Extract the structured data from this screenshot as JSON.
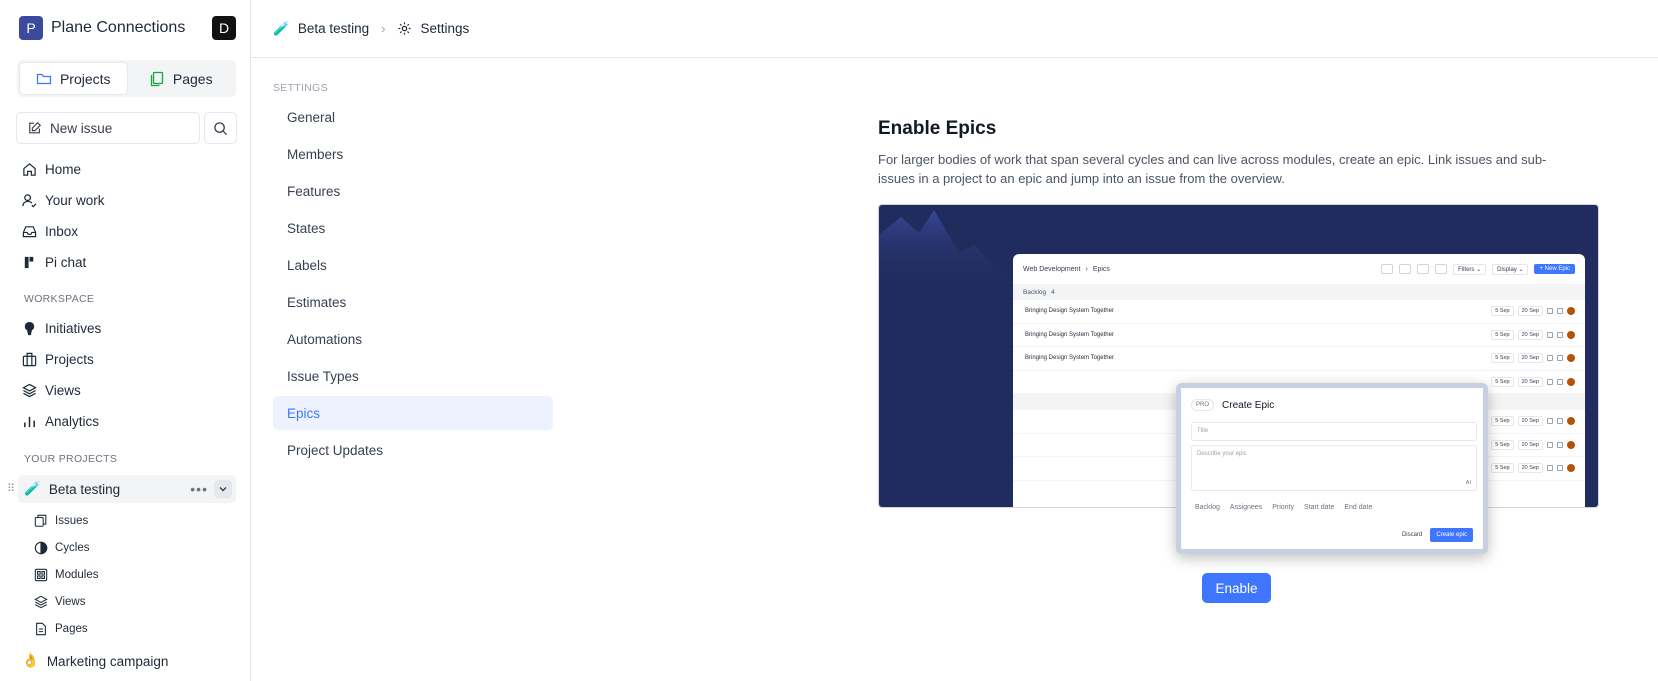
{
  "sidebar": {
    "workspace": {
      "logo_letter": "P",
      "name": "Plane Connections",
      "user_letter": "D"
    },
    "tabs": {
      "projects": "Projects",
      "pages": "Pages"
    },
    "new_issue": "New issue",
    "nav": [
      {
        "label": "Home",
        "icon": "home-icon"
      },
      {
        "label": "Your work",
        "icon": "user-work-icon"
      },
      {
        "label": "Inbox",
        "icon": "inbox-icon"
      },
      {
        "label": "Pi chat",
        "icon": "pi-chat-icon"
      }
    ],
    "workspace_label": "WORKSPACE",
    "workspace_items": [
      {
        "label": "Initiatives",
        "icon": "initiatives-icon"
      },
      {
        "label": "Projects",
        "icon": "briefcase-icon"
      },
      {
        "label": "Views",
        "icon": "layers-icon"
      },
      {
        "label": "Analytics",
        "icon": "bar-chart-icon"
      }
    ],
    "projects_label": "YOUR PROJECTS",
    "active_project": {
      "emoji": "🧪",
      "name": "Beta testing"
    },
    "project_items": [
      {
        "label": "Issues",
        "icon": "issues-icon"
      },
      {
        "label": "Cycles",
        "icon": "cycles-icon"
      },
      {
        "label": "Modules",
        "icon": "modules-icon"
      },
      {
        "label": "Views",
        "icon": "layers-icon"
      },
      {
        "label": "Pages",
        "icon": "page-icon"
      }
    ],
    "other_project": {
      "emoji": "👌",
      "name": "Marketing campaign"
    }
  },
  "header": {
    "project_emoji": "🧪",
    "project": "Beta testing",
    "separator": "›",
    "page": "Settings"
  },
  "settings": {
    "label": "SETTINGS",
    "items": [
      "General",
      "Members",
      "Features",
      "States",
      "Labels",
      "Estimates",
      "Automations",
      "Issue Types",
      "Epics",
      "Project Updates"
    ],
    "active_index": 8
  },
  "content": {
    "title": "Enable Epics",
    "description": "For larger bodies of work that span several cycles and can live across modules, create an epic. Link issues and sub-issues in a project to an epic and jump into an issue from the overview.",
    "enable_label": "Enable"
  },
  "preview": {
    "breadcrumb_project": "Web Development",
    "breadcrumb_page": "Epics",
    "filters": "Filters ⌄",
    "display": "Display ⌄",
    "new_epic": "+ New Epic",
    "group": "Backlog",
    "group_count": "4",
    "row_title": "Bringing Design System Together",
    "start": "5 Sep",
    "end": "20 Sep",
    "modal": {
      "badge": "PRO",
      "title": "Create Epic",
      "title_placeholder": "Title",
      "desc_placeholder": "Describe your epic",
      "ai": "AI",
      "props": [
        "Backlog",
        "Assignees",
        "Priority",
        "Start date",
        "End date"
      ],
      "discard": "Discard",
      "create": "Create epic"
    }
  },
  "colors": {
    "accent": "#3f76ff",
    "preview_bg": "#212c5e",
    "active_bg": "#eef2ff"
  }
}
